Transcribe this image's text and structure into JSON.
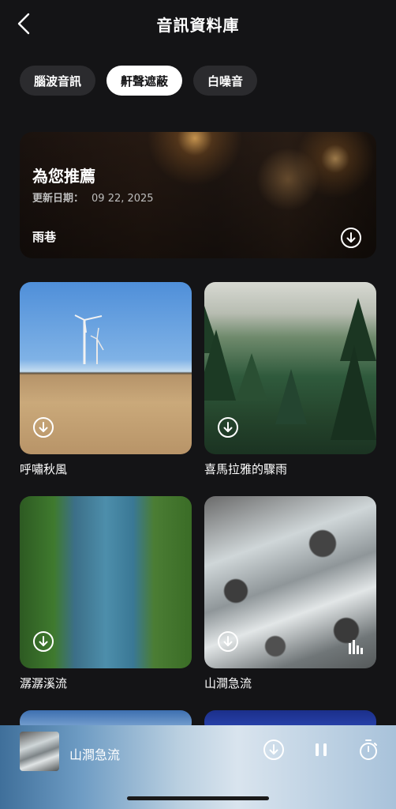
{
  "header": {
    "title": "音訊資料庫"
  },
  "tabs": [
    {
      "label": "腦波音訊",
      "active": false
    },
    {
      "label": "鼾聲遮蔽",
      "active": true
    },
    {
      "label": "白噪音",
      "active": false
    }
  ],
  "featured": {
    "heading": "為您推薦",
    "date_label": "更新日期：",
    "date_value": "09 22, 2025",
    "track": "雨巷"
  },
  "cards": [
    {
      "title": "呼嘯秋風"
    },
    {
      "title": "喜馬拉雅的驟雨"
    },
    {
      "title": "潺潺溪流"
    },
    {
      "title": "山澗急流",
      "playing": true
    }
  ],
  "player": {
    "title": "山澗急流"
  },
  "icons": {
    "back": "chevron-left-icon",
    "download": "download-circle-icon",
    "pause": "pause-icon",
    "timer": "timer-icon",
    "equalizer": "equalizer-icon"
  }
}
